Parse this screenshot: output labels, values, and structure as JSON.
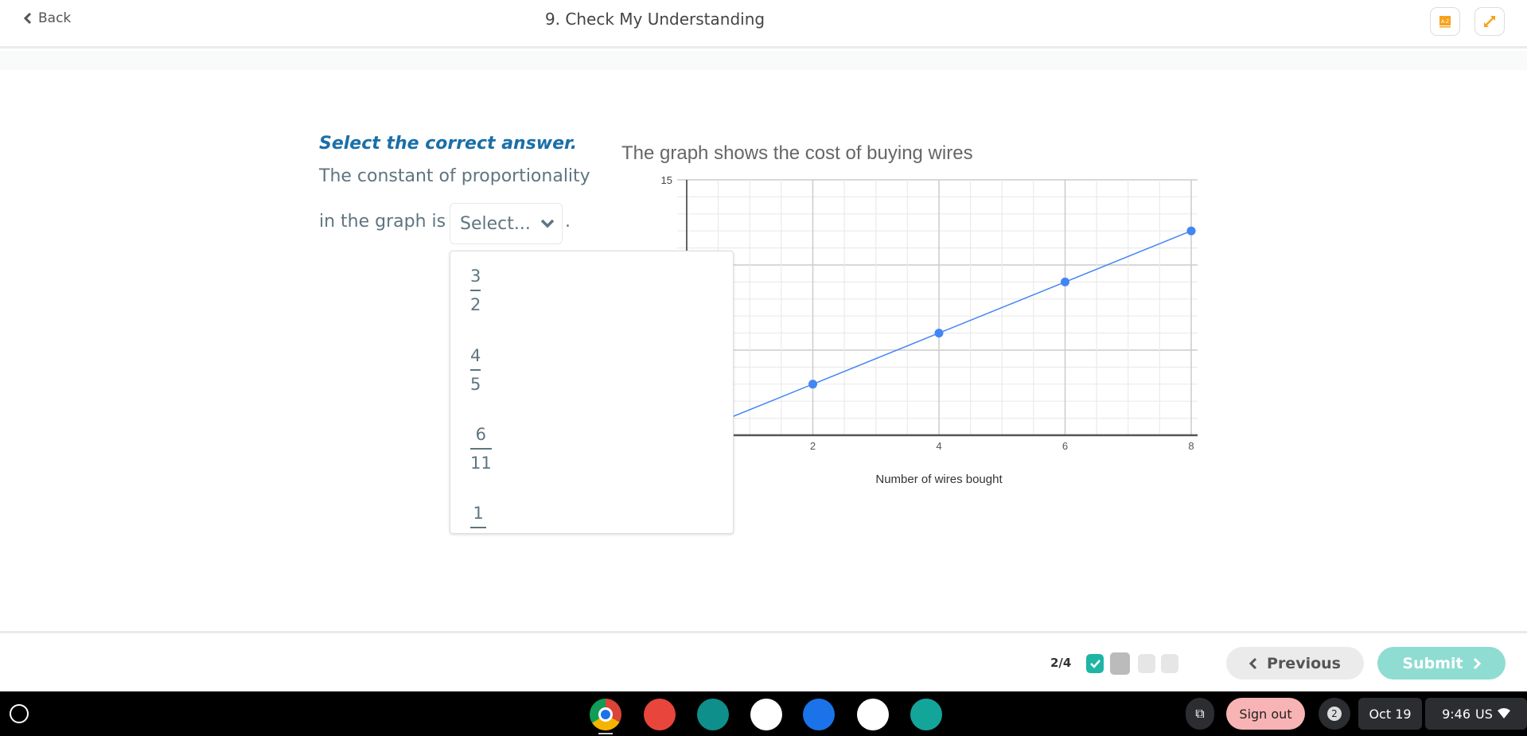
{
  "header": {
    "back_label": "Back",
    "title": "9. Check My Understanding",
    "icons": [
      "glossary-az-icon",
      "expand-icon"
    ],
    "accent": "#f7a21b"
  },
  "question": {
    "instruction": "Select the correct answer.",
    "line1": "The constant of proportionality",
    "line2": "in the graph is",
    "period": ".",
    "select_placeholder": "Select...",
    "options": [
      {
        "num": "3",
        "den": "2"
      },
      {
        "num": "4",
        "den": "5"
      },
      {
        "num": "6",
        "den": "11"
      },
      {
        "num": "1",
        "den": ""
      }
    ]
  },
  "chart_data": {
    "type": "line",
    "title": "The graph shows the cost of buying wires",
    "xlabel": "Number of wires bought",
    "ylabel": "",
    "x": [
      2,
      4,
      6,
      8
    ],
    "y": [
      3,
      6,
      9,
      12
    ],
    "xlim": [
      0,
      8
    ],
    "ylim": [
      0,
      15
    ],
    "xticks": [
      "2",
      "4",
      "6",
      "8"
    ],
    "yticks_visible": [
      "15"
    ],
    "grid": true,
    "line_color": "#4285f4",
    "line_extends_to_origin": true
  },
  "footer": {
    "progress": "2/4",
    "current": 2,
    "total": 4,
    "previous_label": "Previous",
    "submit_label": "Submit",
    "teal": "#1fb5a5",
    "submit_color": "#8fdcd2"
  },
  "taskbar": {
    "apps": [
      "chrome-icon",
      "paint-icon",
      "classroom-icon",
      "link-icon",
      "files-icon",
      "books-icon",
      "app-icon"
    ],
    "sign_out": "Sign out",
    "notifications": "2",
    "date": "Oct 19",
    "time": "9:46",
    "locale": "US"
  }
}
